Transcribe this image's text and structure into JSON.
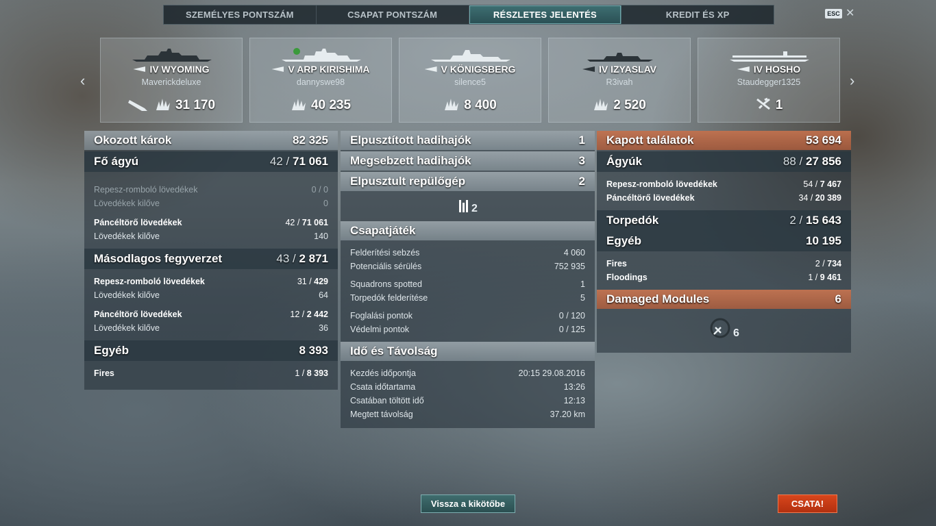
{
  "tabs": [
    "SZEMÉLYES PONTSZÁM",
    "CSAPAT PONTSZÁM",
    "RÉSZLETES JELENTÉS",
    "KREDIT ÉS XP"
  ],
  "active_tab": 2,
  "esc": "ESC",
  "close": "✕",
  "nav": {
    "left": "‹",
    "right": "›"
  },
  "cards": [
    {
      "name": "IV WYOMING",
      "player": "Maverickdeluxe",
      "stat": "31 170"
    },
    {
      "name": "V ARP KIRISHIMA",
      "player": "dannyswe98",
      "stat": "40 235"
    },
    {
      "name": "V KÖNIGSBERG",
      "player": "silence5",
      "stat": "8 400"
    },
    {
      "name": "IV IZYASLAV",
      "player": "R3ivah",
      "stat": "2 520"
    },
    {
      "name": "IV HOSHO",
      "player": "Staudegger1325",
      "stat": "1"
    }
  ],
  "left": {
    "title": "Okozott károk",
    "total": "82 325",
    "main": {
      "label": "Fő ágyú",
      "a": "42",
      "b": "71 061"
    },
    "he": {
      "label": "Repesz-romboló lövedékek",
      "v": "0 / 0",
      "shots_label": "Lövedékek kilőve",
      "shots": "0"
    },
    "ap": {
      "label": "Páncéltörő lövedékek",
      "a": "42",
      "b": "71 061",
      "shots_label": "Lövedékek kilőve",
      "shots": "140"
    },
    "secondary": {
      "label": "Másodlagos fegyverzet",
      "a": "43",
      "b": "2 871"
    },
    "sec_he": {
      "label": "Repesz-romboló lövedékek",
      "a": "31",
      "b": "429",
      "shots_label": "Lövedékek kilőve",
      "shots": "64"
    },
    "sec_ap": {
      "label": "Páncéltörő lövedékek",
      "a": "12",
      "b": "2 442",
      "shots_label": "Lövedékek kilőve",
      "shots": "36"
    },
    "other": {
      "label": "Egyéb",
      "v": "8 393"
    },
    "fires": {
      "label": "Fires",
      "a": "1",
      "b": "8 393"
    }
  },
  "middle": {
    "destroyed": {
      "label": "Elpusztított hadihajók",
      "v": "1"
    },
    "damaged": {
      "label": "Megsebzett hadihajók",
      "v": "3"
    },
    "planes": {
      "label": "Elpusztult repülőgép",
      "v": "2"
    },
    "ribbon_count": "2",
    "team": {
      "label": "Csapatjáték",
      "rows": [
        {
          "label": "Felderítési sebzés",
          "v": "4 060"
        },
        {
          "label": "Potenciális sérülés",
          "v": "752 935"
        },
        {
          "label": "Squadrons spotted",
          "v": "1"
        },
        {
          "label": "Torpedók felderítése",
          "v": "5"
        },
        {
          "label": "Foglalási pontok",
          "v": "0 / 120"
        },
        {
          "label": "Védelmi pontok",
          "v": "0 / 125"
        }
      ]
    },
    "time": {
      "label": "Idő és Távolság",
      "rows": [
        {
          "label": "Kezdés időpontja",
          "v": "20:15  29.08.2016"
        },
        {
          "label": "Csata időtartama",
          "v": "13:26"
        },
        {
          "label": "Csatában töltött idő",
          "v": "12:13"
        },
        {
          "label": "Megtett távolság",
          "v": "37.20 km"
        }
      ]
    }
  },
  "right": {
    "title": "Kapott találatok",
    "total": "53 694",
    "guns": {
      "label": "Ágyúk",
      "a": "88",
      "b": "27 856"
    },
    "he": {
      "label": "Repesz-romboló lövedékek",
      "a": "54",
      "b": "7 467"
    },
    "ap": {
      "label": "Páncéltörő lövedékek",
      "a": "34",
      "b": "20 389"
    },
    "torp": {
      "label": "Torpedók",
      "a": "2",
      "b": "15 643"
    },
    "other": {
      "label": "Egyéb",
      "v": "10 195"
    },
    "fires": {
      "label": "Fires",
      "a": "2",
      "b": "734"
    },
    "floods": {
      "label": "Floodings",
      "a": "1",
      "b": "9 461"
    },
    "modules": {
      "label": "Damaged Modules",
      "v": "6"
    },
    "modules_count": "6"
  },
  "buttons": {
    "back": "Vissza a kikötőbe",
    "battle": "CSATA!"
  }
}
